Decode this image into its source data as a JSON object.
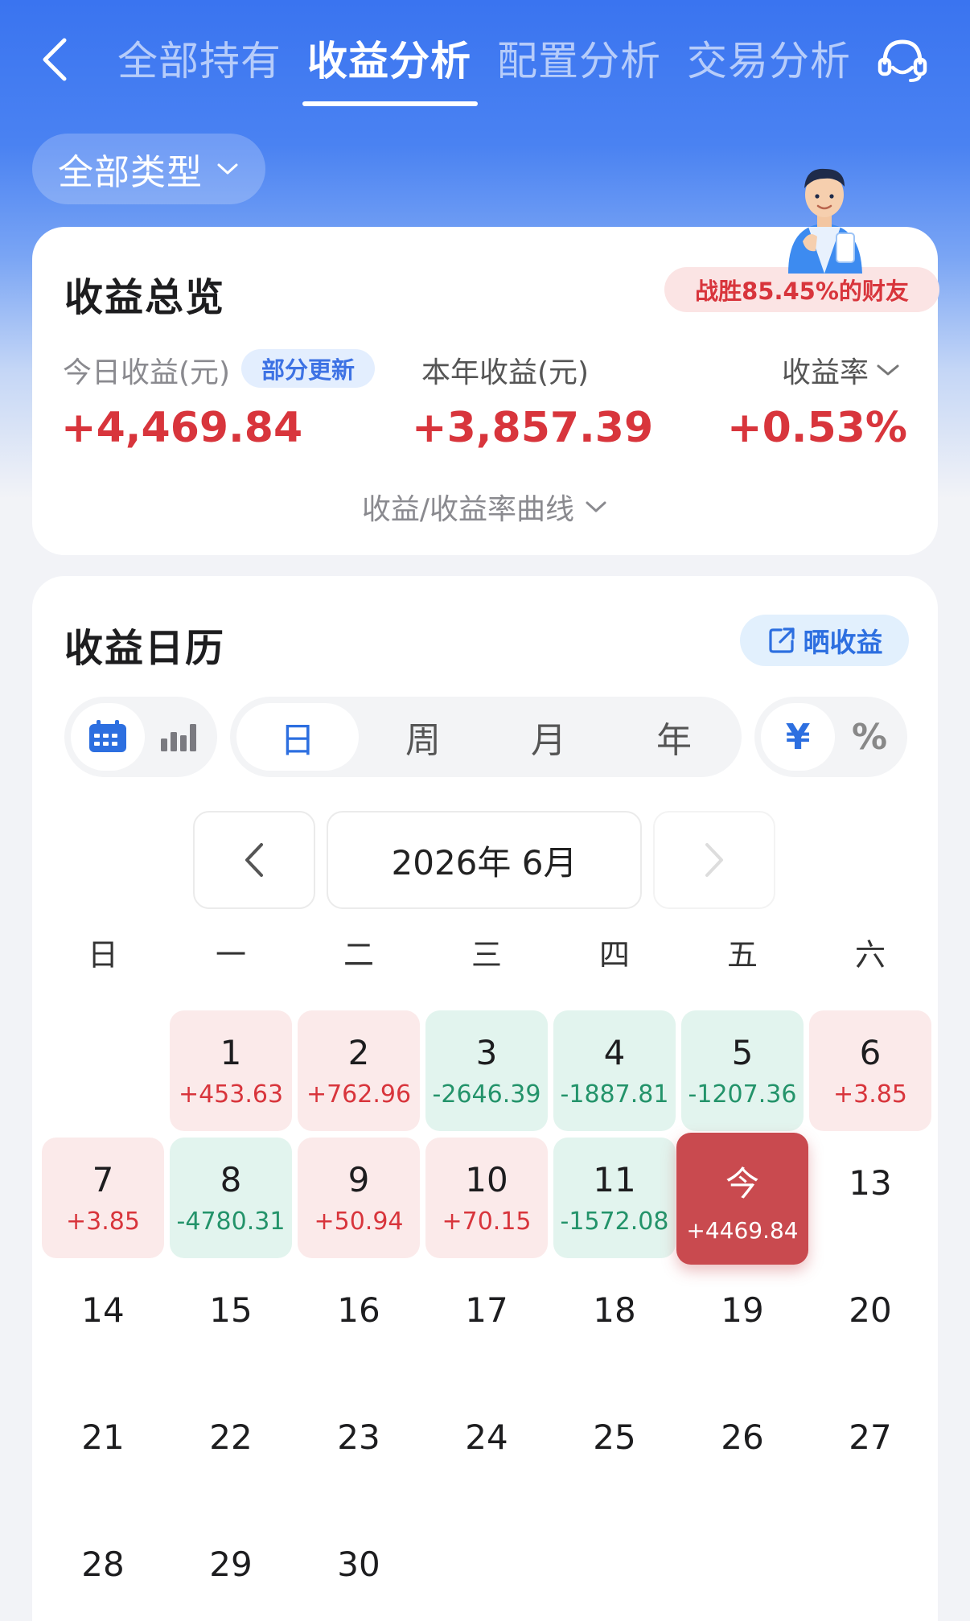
{
  "nav": {
    "tabs": [
      {
        "label": "全部持有"
      },
      {
        "label": "收益分析"
      },
      {
        "label": "配置分析"
      },
      {
        "label": "交易分析"
      }
    ]
  },
  "filter": {
    "label": "全部类型"
  },
  "overview": {
    "title": "收益总览",
    "beat_badge": "战胜85.45%的财友",
    "today_label": "今日收益(元)",
    "update_badge": "部分更新",
    "today_value": "+4,469.84",
    "year_label": "本年收益(元)",
    "year_value": "+3,857.39",
    "rate_label": "收益率",
    "rate_value": "+0.53%",
    "curve_toggle": "收益/收益率曲线"
  },
  "calendar": {
    "title": "收益日历",
    "share_label": "晒收益",
    "periods": [
      "日",
      "周",
      "月",
      "年"
    ],
    "selected_period": "日",
    "units": [
      "¥",
      "%"
    ],
    "selected_unit": "¥",
    "month_label": "2026年 6月",
    "weekdays": [
      "日",
      "一",
      "二",
      "三",
      "四",
      "五",
      "六"
    ],
    "days": [
      {
        "day": "1",
        "value": "+453.63",
        "trend": "up"
      },
      {
        "day": "2",
        "value": "+762.96",
        "trend": "up"
      },
      {
        "day": "3",
        "value": "-2646.39",
        "trend": "down"
      },
      {
        "day": "4",
        "value": "-1887.81",
        "trend": "down"
      },
      {
        "day": "5",
        "value": "-1207.36",
        "trend": "down"
      },
      {
        "day": "6",
        "value": "+3.85",
        "trend": "up"
      },
      {
        "day": "7",
        "value": "+3.85",
        "trend": "up"
      },
      {
        "day": "8",
        "value": "-4780.31",
        "trend": "down"
      },
      {
        "day": "9",
        "value": "+50.94",
        "trend": "up"
      },
      {
        "day": "10",
        "value": "+70.15",
        "trend": "up"
      },
      {
        "day": "11",
        "value": "-1572.08",
        "trend": "down"
      },
      {
        "day": "今",
        "value": "+4469.84",
        "trend": "today"
      },
      {
        "day": "13",
        "value": "",
        "trend": "none"
      },
      {
        "day": "14",
        "value": "",
        "trend": "none"
      },
      {
        "day": "15",
        "value": "",
        "trend": "none"
      },
      {
        "day": "16",
        "value": "",
        "trend": "none"
      },
      {
        "day": "17",
        "value": "",
        "trend": "none"
      },
      {
        "day": "18",
        "value": "",
        "trend": "none"
      },
      {
        "day": "19",
        "value": "",
        "trend": "none"
      },
      {
        "day": "20",
        "value": "",
        "trend": "none"
      },
      {
        "day": "21",
        "value": "",
        "trend": "none"
      },
      {
        "day": "22",
        "value": "",
        "trend": "none"
      },
      {
        "day": "23",
        "value": "",
        "trend": "none"
      },
      {
        "day": "24",
        "value": "",
        "trend": "none"
      },
      {
        "day": "25",
        "value": "",
        "trend": "none"
      },
      {
        "day": "26",
        "value": "",
        "trend": "none"
      },
      {
        "day": "27",
        "value": "",
        "trend": "none"
      },
      {
        "day": "28",
        "value": "",
        "trend": "none"
      },
      {
        "day": "29",
        "value": "",
        "trend": "none"
      },
      {
        "day": "30",
        "value": "",
        "trend": "none"
      }
    ]
  },
  "colors": {
    "accent": "#2d6fe0",
    "gain": "#d8353c",
    "loss": "#23936a",
    "header_blue": "#3a74f0"
  }
}
